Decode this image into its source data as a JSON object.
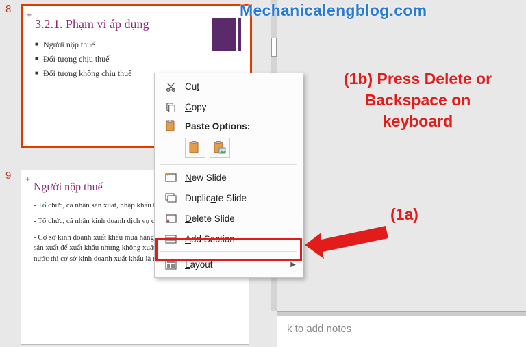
{
  "watermark": "Mechanicalengblog.com",
  "slides": {
    "num8": "8",
    "num9": "9",
    "slide8": {
      "title": "3.2.1. Phạm vi áp dụng",
      "bullets": [
        "Người nộp thuế",
        "Đối tượng chịu thuế",
        "Đối tượng không chịu thuế"
      ]
    },
    "slide9": {
      "title": "Người nộp thuế",
      "p1": "- Tổ chức, cá nhân sản xuất, nhập khẩu hàng hoá chịu thuế TTĐB",
      "p2": "- Tổ chức, cá nhân kinh doanh dịch vụ chịu thuế TTĐB",
      "p3": "- Cơ sở kinh doanh xuất khẩu mua hàng chịu thuế TTĐB của cơ sở sản xuất để xuất khẩu nhưng không xuất khẩu mà tiêu thụ trong nước thì cơ sở kinh doanh xuất khẩu là người nộp thuế TTĐB"
    }
  },
  "menu": {
    "cut": "Cut",
    "copy": "Copy",
    "paste_header": "Paste Options:",
    "new_slide": "New Slide",
    "duplicate_slide": "Duplicate Slide",
    "delete_slide": "Delete Slide",
    "add_section": "Add Section",
    "layout": "Layout"
  },
  "notes": {
    "placeholder": "k to add notes"
  },
  "annotations": {
    "anno1b_line1": "(1b) Press Delete or",
    "anno1b_line2": "Backspace on",
    "anno1b_line3": "keyboard",
    "anno1a": "(1a)"
  }
}
